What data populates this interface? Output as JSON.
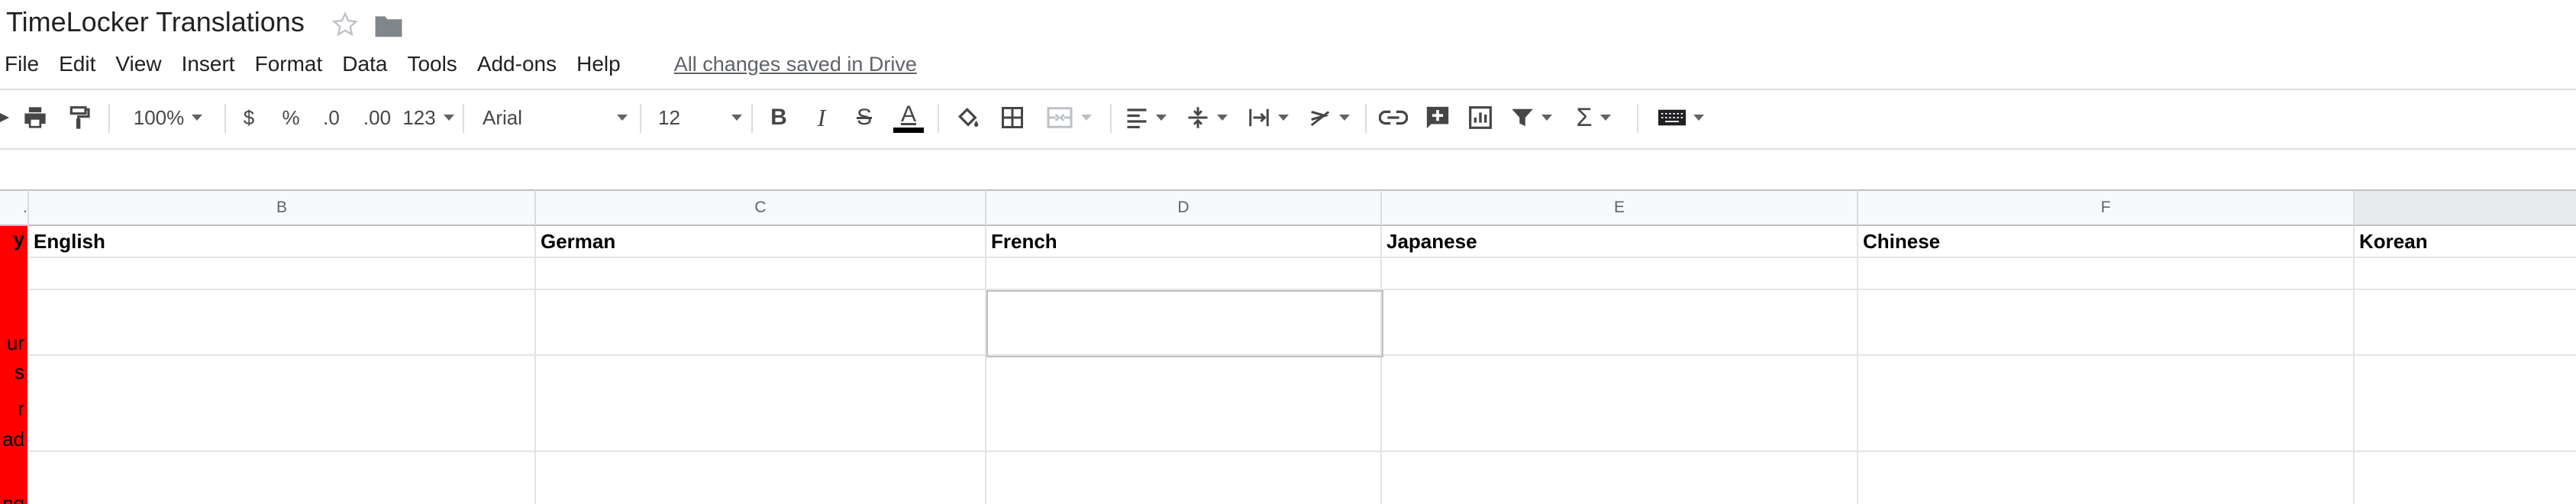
{
  "document": {
    "title": "TimeLocker Translations"
  },
  "menu": {
    "items": [
      "File",
      "Edit",
      "View",
      "Insert",
      "Format",
      "Data",
      "Tools",
      "Add-ons",
      "Help"
    ],
    "save_status": "All changes saved in Drive"
  },
  "toolbar": {
    "zoom": "100%",
    "currency": "$",
    "percent": "%",
    "decrease_decimal": ".0",
    "increase_decimal": ".00",
    "number_format": "123",
    "font": "Arial",
    "font_size": "12"
  },
  "sheet": {
    "column_letters": [
      "B",
      "C",
      "D",
      "E",
      "F"
    ],
    "header_row": [
      "English",
      "German",
      "French",
      "Japanese",
      "Chinese",
      "Korean"
    ],
    "partial_column_a": {
      "header_letter": "y",
      "fragments": [
        "ur",
        "s",
        "r",
        "ad",
        "ng"
      ]
    }
  },
  "colors": {
    "accent_red": "#ff0000",
    "text_underline": "#000000"
  }
}
